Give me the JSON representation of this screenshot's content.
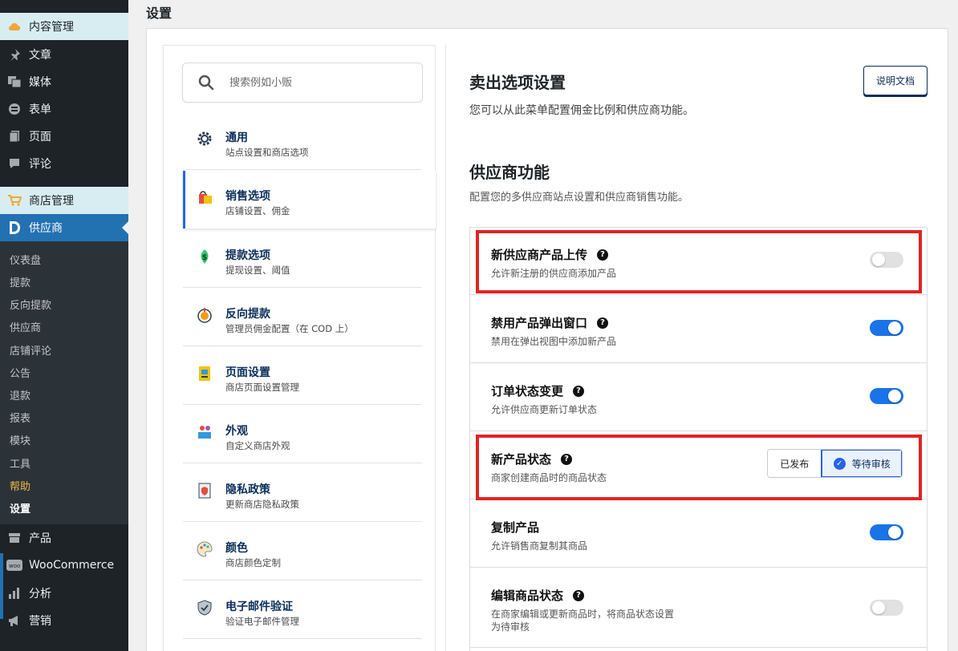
{
  "sidebar": {
    "top_items": [
      {
        "label": "内容管理",
        "icon": "cloud-icon"
      },
      {
        "label": "文章",
        "icon": "pin-icon"
      },
      {
        "label": "媒体",
        "icon": "media-icon"
      },
      {
        "label": "表单",
        "icon": "form-icon"
      },
      {
        "label": "页面",
        "icon": "page-icon"
      },
      {
        "label": "评论",
        "icon": "comment-icon"
      },
      {
        "label": "商店管理",
        "icon": "cart-icon"
      },
      {
        "label": "供应商",
        "icon": "dokan-icon"
      }
    ],
    "sub_items": [
      "仪表盘",
      "提款",
      "反向提款",
      "供应商",
      "店铺评论",
      "公告",
      "退款",
      "报表",
      "模块",
      "工具",
      "帮助",
      "设置"
    ],
    "bottom_items": [
      {
        "label": "产品",
        "icon": "product-icon"
      },
      {
        "label": "WooCommerce",
        "icon": "woo-icon"
      },
      {
        "label": "分析",
        "icon": "bar-chart-icon"
      },
      {
        "label": "营销",
        "icon": "megaphone-icon"
      }
    ]
  },
  "page": {
    "title": "设置"
  },
  "search": {
    "placeholder": "搜索例如小贩"
  },
  "nav": [
    {
      "title": "通用",
      "desc": "站点设置和商店选项",
      "icon": "gear-icon"
    },
    {
      "title": "销售选项",
      "desc": "店铺设置、佣金",
      "icon": "shopping-bag-icon"
    },
    {
      "title": "提款选项",
      "desc": "提现设置、阈值",
      "icon": "money-icon"
    },
    {
      "title": "反向提款",
      "desc": "管理员佣金配置（在 COD 上）",
      "icon": "reverse-withdraw-icon"
    },
    {
      "title": "页面设置",
      "desc": "商店页面设置管理",
      "icon": "page-settings-icon"
    },
    {
      "title": "外观",
      "desc": "自定义商店外观",
      "icon": "appearance-icon"
    },
    {
      "title": "隐私政策",
      "desc": "更新商店隐私政策",
      "icon": "privacy-icon"
    },
    {
      "title": "颜色",
      "desc": "商店颜色定制",
      "icon": "palette-icon"
    },
    {
      "title": "电子邮件验证",
      "desc": "验证电子邮件管理",
      "icon": "shield-icon"
    }
  ],
  "content": {
    "section_title": "卖出选项设置",
    "section_desc": "您可以从此菜单配置佣金比例和供应商功能。",
    "doc_button": "说明文档",
    "vendor_title": "供应商功能",
    "vendor_desc": "配置您的多供应商站点设置和供应商销售功能。"
  },
  "settings": [
    {
      "title": "新供应商产品上传",
      "desc": "允许新注册的供应商添加产品",
      "help": "?",
      "toggle": false
    },
    {
      "title": "禁用产品弹出窗口",
      "desc": "禁用在弹出视图中添加新产品",
      "help": "?",
      "toggle": true
    },
    {
      "title": "订单状态变更",
      "desc": "允许供应商更新订单状态",
      "help": "?",
      "toggle": true
    },
    {
      "title": "新产品状态",
      "desc": "商家创建商品时的商品状态",
      "help": "?",
      "options": [
        "已发布",
        "等待审核"
      ],
      "selected": "等待审核"
    },
    {
      "title": "复制产品",
      "desc": "允许销售商复制其商品",
      "toggle": true
    },
    {
      "title": "编辑商品状态",
      "desc": "在商家编辑或更新商品时，将商品状态设置",
      "desc2": "为待审核",
      "help": "?",
      "toggle": false
    }
  ],
  "colors": {
    "accent": "#2563eb",
    "toggle_on": "#1a73e8",
    "highlight": "#e02424",
    "wp_blue": "#2271b1"
  }
}
